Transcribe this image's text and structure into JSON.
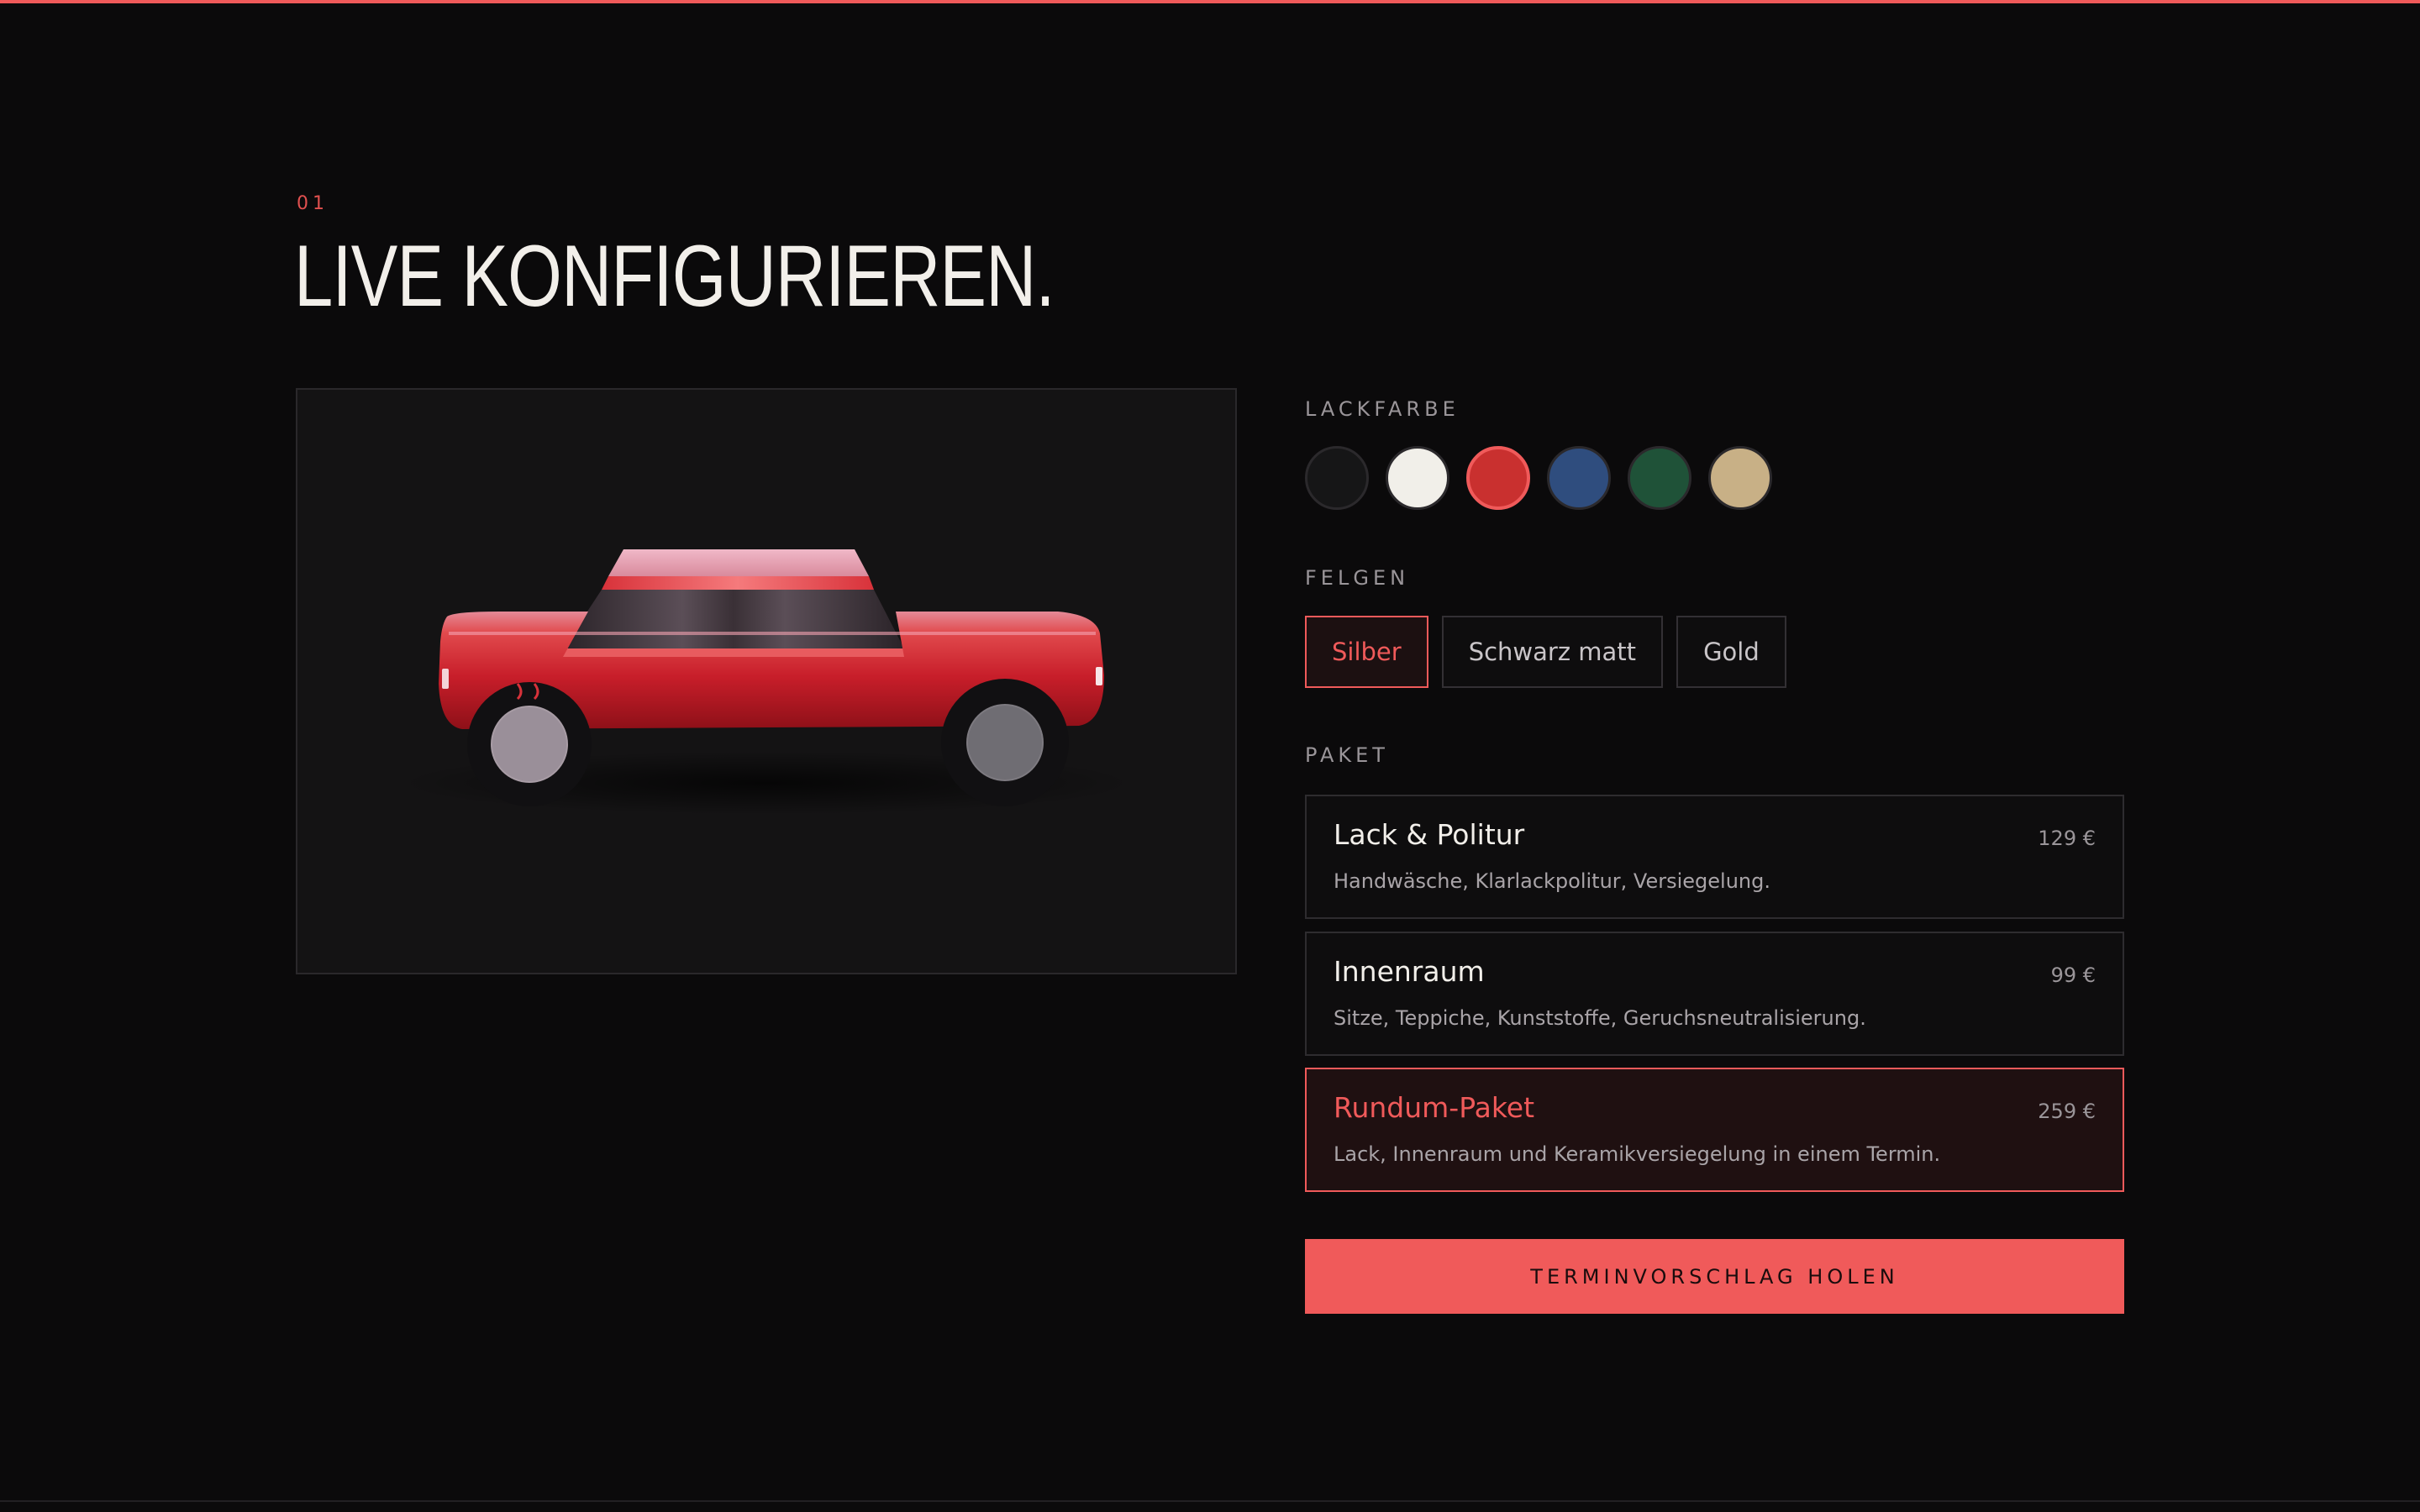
{
  "section": {
    "number": "01",
    "title": "LIVE KONFIGURIEREN."
  },
  "configurator": {
    "paint": {
      "label": "LACKFARBE",
      "options": [
        {
          "name": "black",
          "color": "#161617"
        },
        {
          "name": "white",
          "color": "#f1efe9"
        },
        {
          "name": "red",
          "color": "#c9302f",
          "selected": true
        },
        {
          "name": "blue",
          "color": "#2f4d7e"
        },
        {
          "name": "green",
          "color": "#1f5238"
        },
        {
          "name": "beige",
          "color": "#c8b086"
        }
      ]
    },
    "rims": {
      "label": "FELGEN",
      "options": [
        "Silber",
        "Schwarz matt",
        "Gold"
      ],
      "selected": "Silber"
    },
    "package": {
      "label": "PAKET",
      "options": [
        {
          "name": "Lack & Politur",
          "price": "129 €",
          "description": "Handwäsche, Klarlackpolitur, Versiegelung."
        },
        {
          "name": "Innenraum",
          "price": "99 €",
          "description": "Sitze, Teppiche, Kunststoffe, Geruchsneutralisierung."
        },
        {
          "name": "Rundum-Paket",
          "price": "259 €",
          "description": "Lack, Innenraum und Keramikversiegelung in einem Termin.",
          "selected": true
        }
      ]
    },
    "cta_label": "TERMINVORSCHLAG HOLEN"
  },
  "colors": {
    "accent": "#f05a5a",
    "background": "#0b0a0b",
    "panel": "#141314"
  }
}
